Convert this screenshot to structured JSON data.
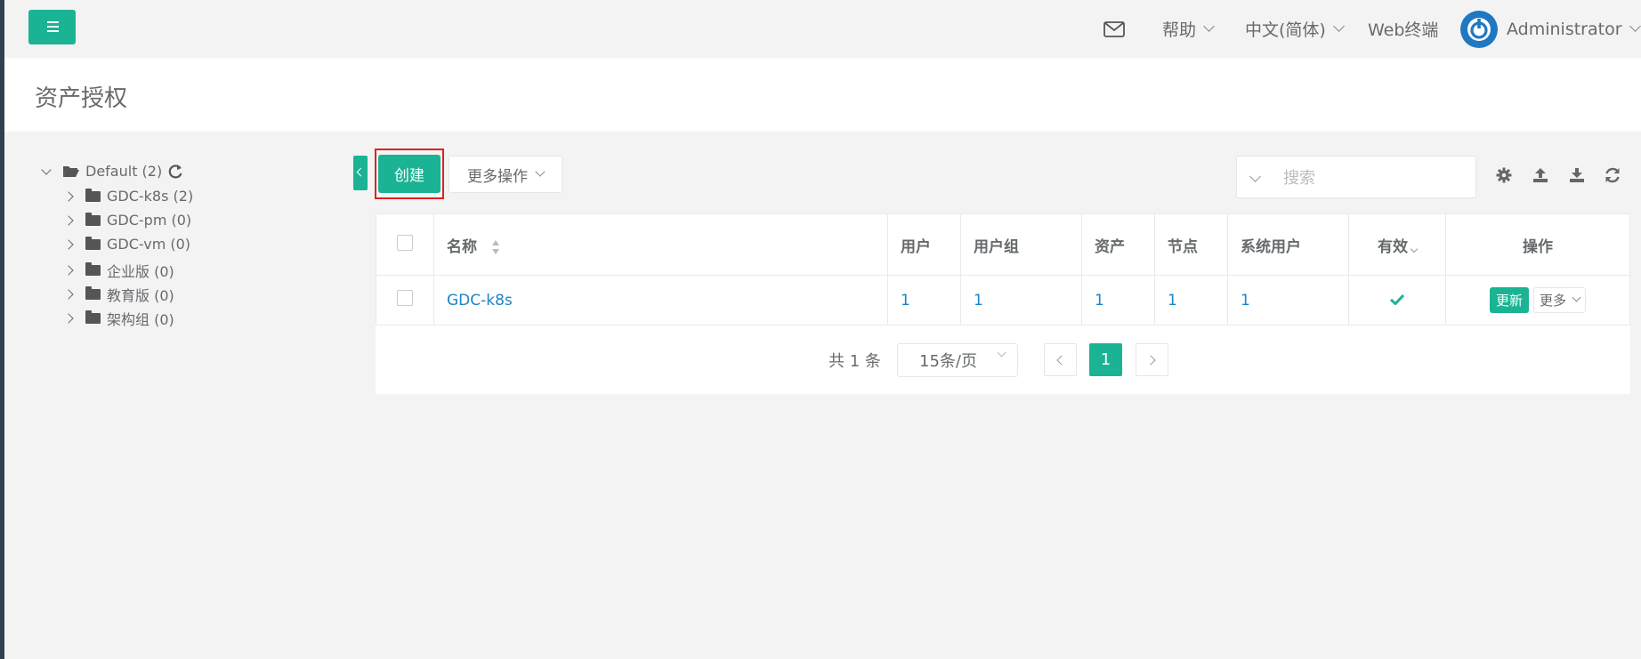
{
  "header": {
    "help_label": "帮助",
    "language_label": "中文(简体)",
    "webterminal_label": "Web终端",
    "username": "Administrator"
  },
  "page": {
    "title": "资产授权"
  },
  "tree": {
    "root": {
      "label": "Default (2)"
    },
    "children": [
      {
        "label": "GDC-k8s (2)"
      },
      {
        "label": "GDC-pm (0)"
      },
      {
        "label": "GDC-vm (0)"
      },
      {
        "label": "企业版 (0)"
      },
      {
        "label": "教育版 (0)"
      },
      {
        "label": "架构组 (0)"
      }
    ]
  },
  "toolbar": {
    "create_label": "创建",
    "more_actions_label": "更多操作",
    "search_placeholder": "搜索"
  },
  "table": {
    "columns": [
      "名称",
      "用户",
      "用户组",
      "资产",
      "节点",
      "系统用户",
      "有效",
      "操作"
    ],
    "rows": [
      {
        "name": "GDC-k8s",
        "users": "1",
        "user_groups": "1",
        "assets": "1",
        "nodes": "1",
        "system_users": "1",
        "valid": true,
        "update_label": "更新",
        "more_label": "更多"
      }
    ]
  },
  "pagination": {
    "total_label": "共 1 条",
    "page_size": "15条/页",
    "current_page": "1"
  },
  "colors": {
    "accent": "#1ab394",
    "link": "#1c84c6",
    "highlight": "#e02020"
  }
}
